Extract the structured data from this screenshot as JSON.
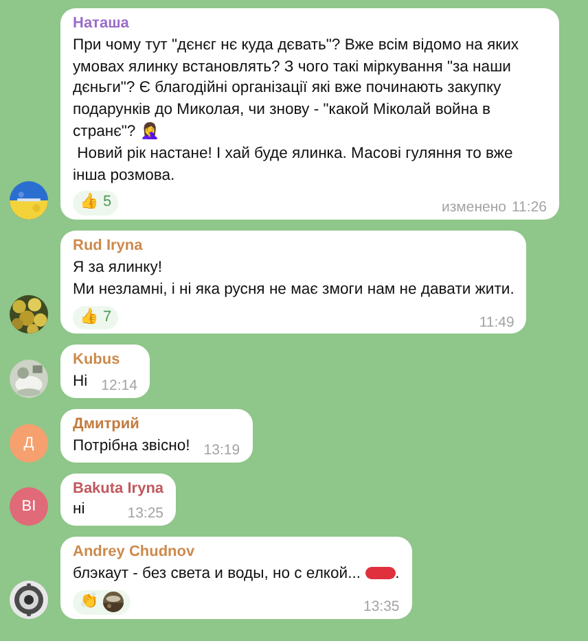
{
  "messages": [
    {
      "author": "Наташа",
      "color": "#9a6cc8",
      "text": "При чому тут \"дєнєг нє куда дєвать\"? Вже всім відомо на яких умовах ялинку встановлять? З чого такі міркування \"за наши дєньги\"? Є благодійні організації які вже починають закупку подарунків до Миколая, чи знову - \"какой Міколай война в странє\"? 🤦‍♀️\n Новий рік настане! І хай буде ялинка. Масові гуляння то вже інша розмова.",
      "reactions": [
        {
          "emoji": "👍",
          "count": "5"
        }
      ],
      "edited_label": "изменено",
      "time": "11:26"
    },
    {
      "author": "Rud Iryna",
      "color": "#cc8a4c",
      "text": "Я за ялинку!\nМи незламні, і ні яка русня не має змоги нам не давати жити.",
      "reactions": [
        {
          "emoji": "👍",
          "count": "7"
        }
      ],
      "time": "11:49"
    },
    {
      "author": "Kubus",
      "color": "#cc8a4c",
      "text": "Hi",
      "time": "12:14"
    },
    {
      "author": "Дмитрий",
      "color": "#c27b3e",
      "avatar": {
        "kind": "letter",
        "letter": "Д",
        "color": "#f5a06e"
      },
      "text": "Потрібна звісно!",
      "time": "13:19"
    },
    {
      "author": "Bakuta Iryna",
      "color": "#c0585e",
      "avatar": {
        "kind": "letter",
        "letter": "BI",
        "color": "#e06a78"
      },
      "text": "ні",
      "time": "13:25"
    },
    {
      "author": "Andrey Chudnov",
      "color": "#cc8a4c",
      "text": "блэкаут - без света и воды, но с елкой... ",
      "redacted": true,
      "text_after": ".",
      "reactions": [
        {
          "emoji": "👏",
          "reactor_photo": true
        }
      ],
      "time": "13:35"
    }
  ]
}
